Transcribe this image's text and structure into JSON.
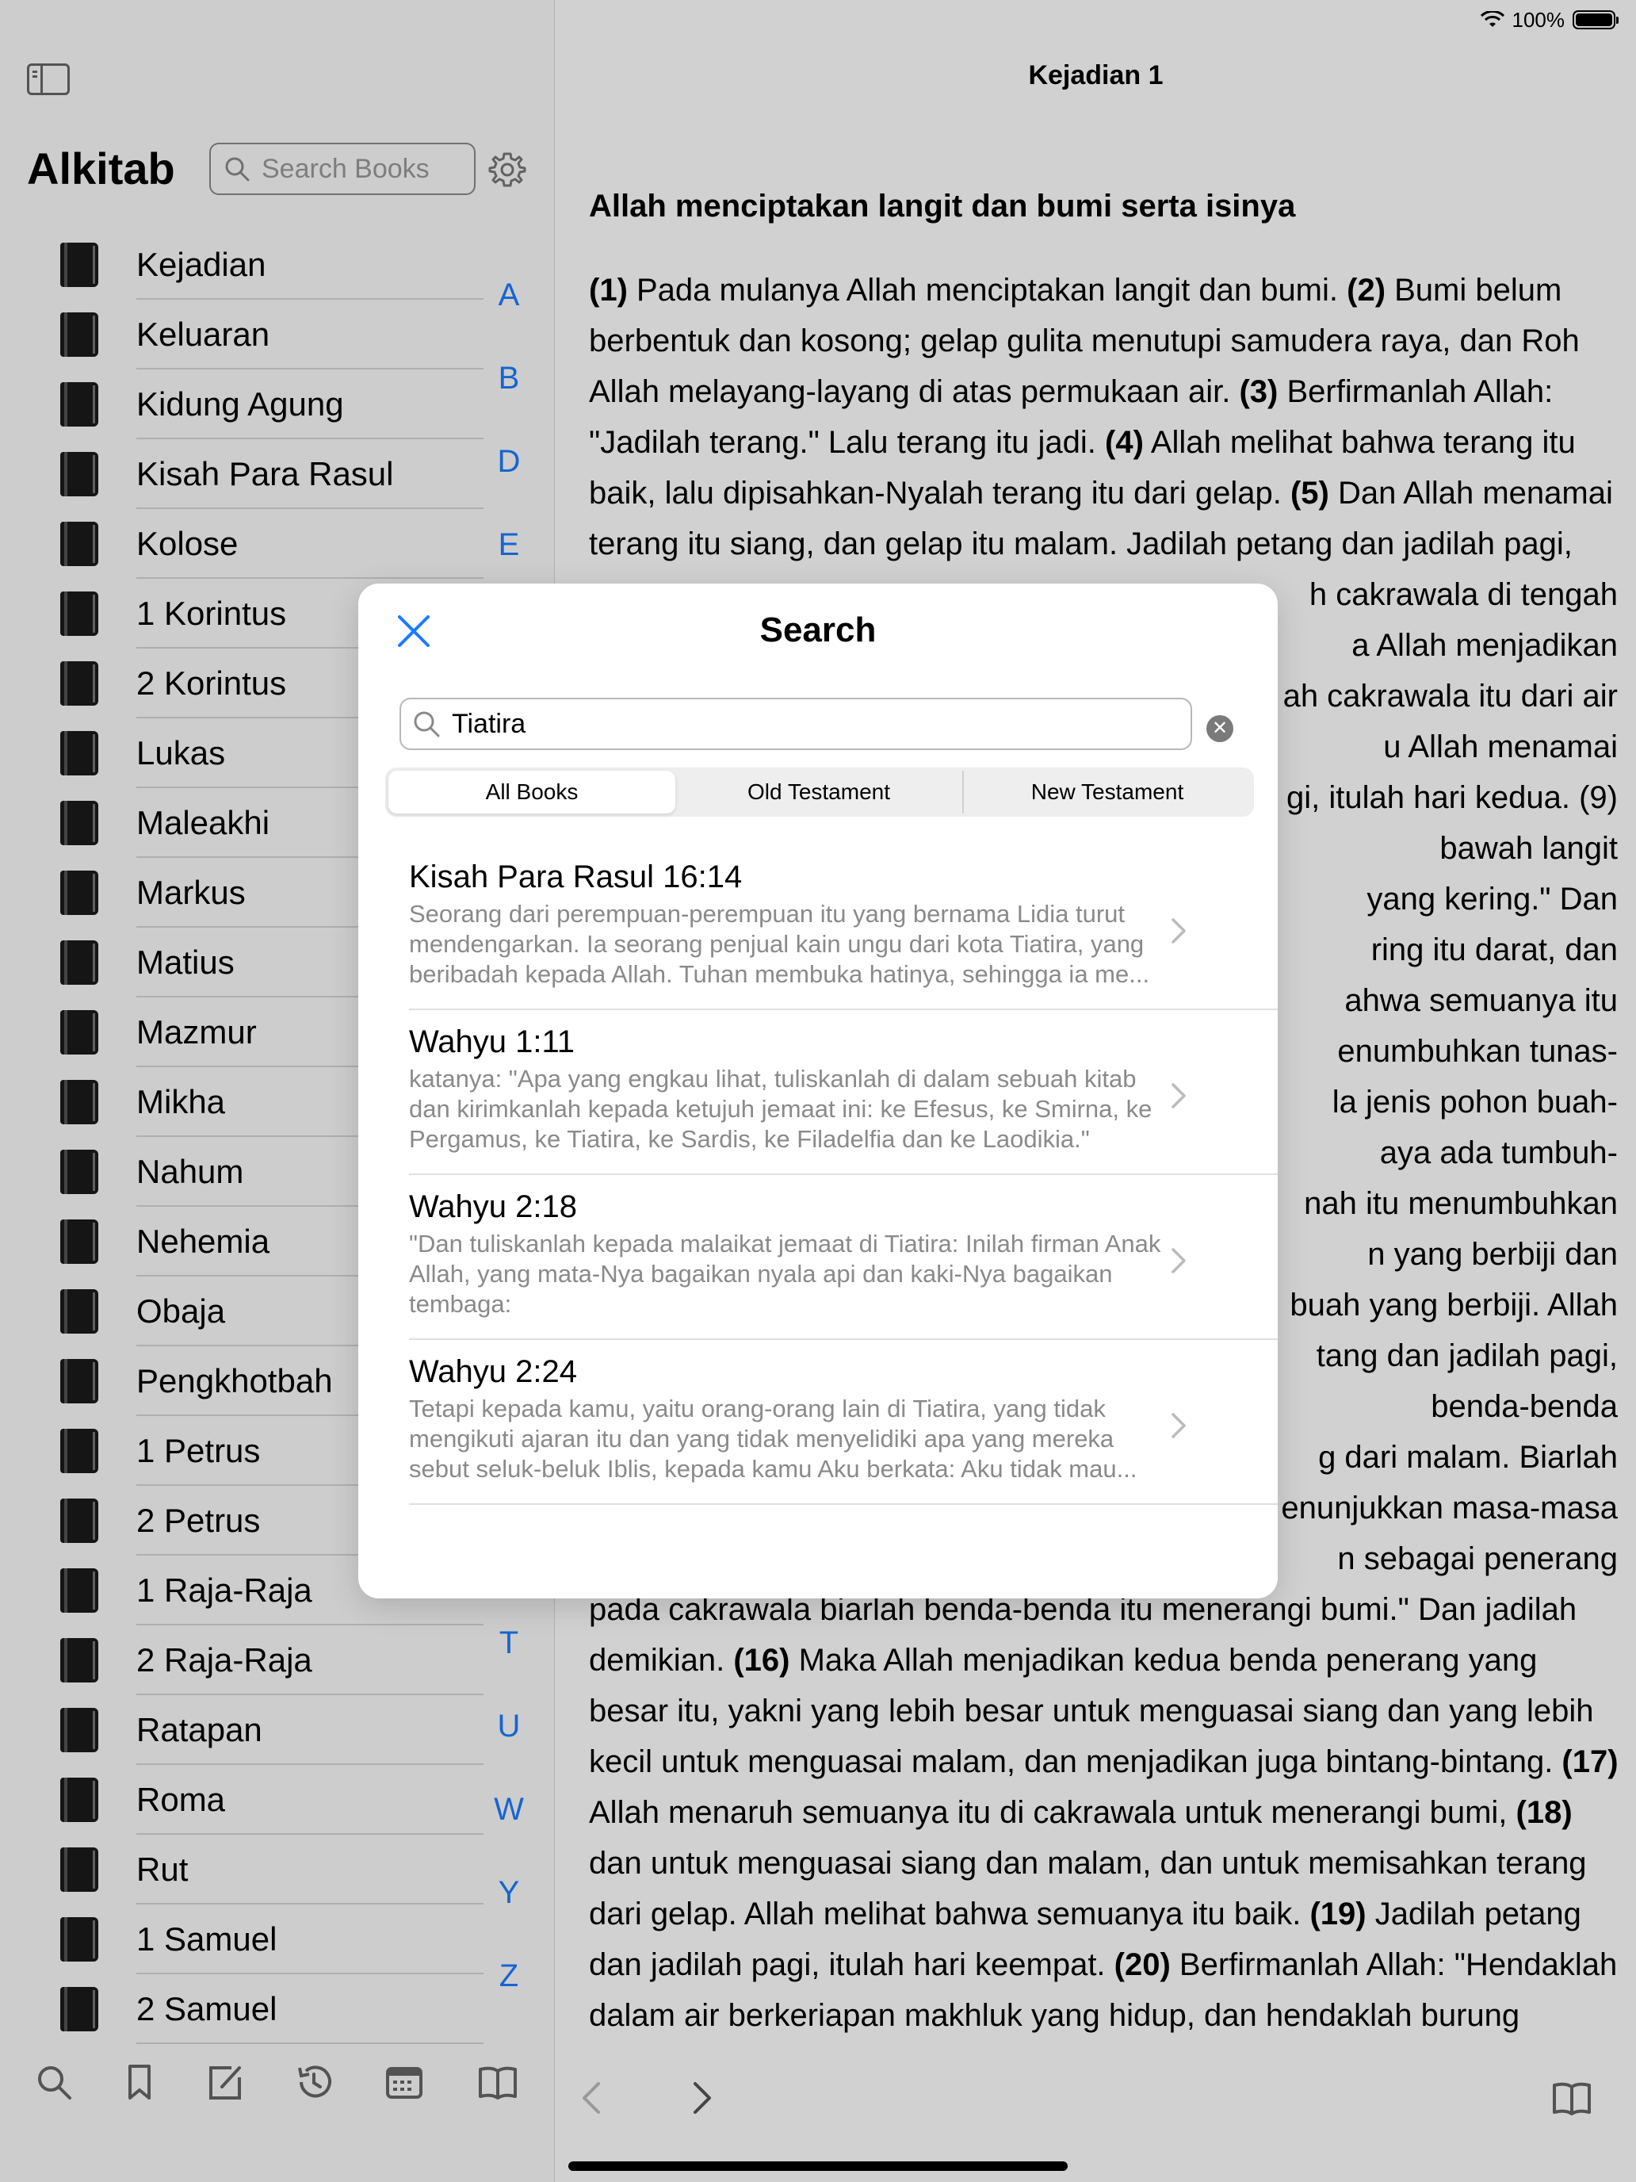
{
  "status": {
    "battery": "100%"
  },
  "sidebar": {
    "title": "Alkitab",
    "search_placeholder": "Search Books",
    "books": [
      "Kejadian",
      "Keluaran",
      "Kidung Agung",
      "Kisah Para Rasul",
      "Kolose",
      "1 Korintus",
      "2 Korintus",
      "Lukas",
      "Maleakhi",
      "Markus",
      "Matius",
      "Mazmur",
      "Mikha",
      "Nahum",
      "Nehemia",
      "Obaja",
      "Pengkhotbah",
      "1 Petrus",
      "2 Petrus",
      "1 Raja-Raja",
      "2 Raja-Raja",
      "Ratapan",
      "Roma",
      "Rut",
      "1 Samuel",
      "2 Samuel"
    ],
    "index_letters": [
      "A",
      "B",
      "D",
      "E",
      "T",
      "U",
      "W",
      "Y",
      "Z"
    ],
    "toolbar_icons": [
      "search-icon",
      "bookmark-icon",
      "compose-icon",
      "history-icon",
      "calendar-icon",
      "book-open-icon"
    ]
  },
  "reader": {
    "chapter_title": "Kejadian 1",
    "section_heading": "Allah menciptakan langit dan bumi serta isinya",
    "verses_top": [
      {
        "n": "(1)",
        "t": " Pada mulanya Allah menciptakan langit dan bumi. "
      },
      {
        "n": "(2)",
        "t": " Bumi belum berbentuk dan kosong; gelap gulita menutupi samudera raya, dan Roh Allah melayang-layang di atas permukaan air. "
      },
      {
        "n": "(3)",
        "t": " Berfirmanlah Allah: \"Jadilah terang.\" Lalu terang itu jadi. "
      },
      {
        "n": "(4)",
        "t": " Allah melihat bahwa terang itu baik, lalu dipisahkan-Nyalah terang itu dari gelap. "
      },
      {
        "n": "(5)",
        "t": " Dan Allah menamai terang itu siang, dan gelap itu malam. Jadilah petang dan jadilah pagi,"
      }
    ],
    "right_fragments": [
      "h cakrawala di tengah",
      "a Allah menjadikan",
      "ah cakrawala itu dari air",
      "u Allah menamai",
      "gi, itulah hari kedua. (9)",
      "bawah langit",
      "yang kering.\" Dan",
      "ring itu darat, dan",
      "ahwa semuanya itu",
      "enumbuhkan tunas-",
      "la jenis pohon buah-",
      "aya ada tumbuh-",
      "nah itu menumbuhkan",
      "n yang berbiji dan",
      "buah yang berbiji. Allah",
      "tang dan jadilah pagi,",
      "benda-benda",
      "g dari malam. Biarlah",
      "enunjukkan masa-masa",
      "n sebagai penerang"
    ],
    "verses_bottom": "pada cakrawala biarlah benda-benda itu menerangi bumi.\" Dan jadilah demikian. ",
    "v16": "(16)",
    "v16_text": " Maka Allah menjadikan kedua benda penerang yang besar itu, yakni yang lebih besar untuk menguasai siang dan yang lebih kecil untuk menguasai malam, dan menjadikan juga bintang-bintang. ",
    "v17": "(17)",
    "v17_text": " Allah menaruh semuanya itu di cakrawala untuk menerangi bumi, ",
    "v18": "(18)",
    "v18_text": " dan untuk menguasai siang dan malam, dan untuk memisahkan terang dari gelap. Allah melihat bahwa semuanya itu baik. ",
    "v19": "(19)",
    "v19_text": " Jadilah petang dan jadilah pagi, itulah hari keempat. ",
    "v20": "(20)",
    "v20_text": " Berfirmanlah Allah: \"Hendaklah dalam air berkeriapan makhluk yang hidup, dan hendaklah burung"
  },
  "modal": {
    "title": "Search",
    "query": "Tiatira",
    "tabs": [
      "All Books",
      "Old Testament",
      "New Testament"
    ],
    "active_tab": "All Books",
    "results": [
      {
        "ref": "Kisah Para Rasul 16:14",
        "text": "Seorang dari perempuan-perempuan itu yang bernama Lidia turut mendengarkan. Ia seorang penjual kain ungu dari kota Tiatira, yang beribadah kepada Allah. Tuhan membuka hatinya, sehingga ia me..."
      },
      {
        "ref": "Wahyu 1:11",
        "text": "katanya: \"Apa yang engkau lihat, tuliskanlah di dalam sebuah kitab dan kirimkanlah kepada ketujuh jemaat ini: ke Efesus, ke Smirna, ke Pergamus, ke Tiatira, ke Sardis, ke Filadelfia dan ke Laodikia.\""
      },
      {
        "ref": "Wahyu 2:18",
        "text": "\"Dan tuliskanlah kepada malaikat jemaat di Tiatira: Inilah firman Anak Allah, yang mata-Nya bagaikan nyala api dan kaki-Nya bagaikan tembaga:"
      },
      {
        "ref": "Wahyu 2:24",
        "text": "Tetapi kepada kamu, yaitu orang-orang lain di Tiatira, yang tidak mengikuti ajaran itu dan yang tidak menyelidiki apa yang mereka sebut seluk-beluk Iblis, kepada kamu Aku berkata: Aku tidak mau..."
      }
    ]
  },
  "colors": {
    "accent": "#1a7cff",
    "secondary_text": "#8a8a8a"
  }
}
